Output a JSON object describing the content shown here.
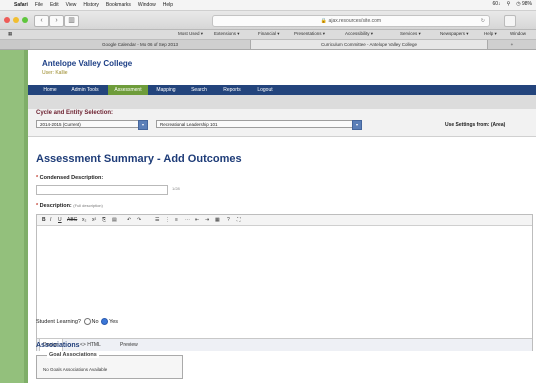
{
  "mac_menubar": {
    "app": "Safari",
    "items": [
      "File",
      "Edit",
      "View",
      "History",
      "Bookmarks",
      "Window",
      "Help"
    ],
    "status": [
      "60↓",
      "⚲",
      "◷ 98%"
    ]
  },
  "browser": {
    "url": "ajax.resources/site.com",
    "bookmarks": [
      "Most Used ▾",
      "Extensions ▾",
      "Financial ▾",
      "Presentations ▾",
      "Accessibility ▾",
      "Services ▾",
      "Newspapers ▾",
      "Help ▾",
      "Window"
    ],
    "tabs": [
      "Google Calendar - Mo 06 of Sep 2013",
      "Curriculum Committee - Antelope Valley College"
    ]
  },
  "site": {
    "college_name": "Antelope Valley College",
    "user_label": "User: Kallie",
    "nav": [
      "Home",
      "Admin Tools",
      "Assessment",
      "Mapping",
      "Search",
      "Reports",
      "Logout"
    ],
    "active_nav": "Assessment"
  },
  "selection": {
    "label": "Cycle and Entity Selection:",
    "cycle": "2014-2015 (Current)",
    "entity": "Recreational Leadership 101",
    "use_settings": "Use Settings from: (Area)"
  },
  "page_title": "Assessment Summary - Add Outcomes",
  "form": {
    "condensed_label": "Condensed Description:",
    "condensed_value": "",
    "counter": "1/28",
    "description_label": "Description:",
    "description_note": "(Full description)",
    "toolbar_icons": [
      "B",
      "I",
      "U",
      "ABC",
      "x₂",
      "x²",
      "⎘",
      "▤",
      "↶",
      "↷",
      "☰",
      "⋮",
      "≡",
      "⋯",
      "⇤",
      "⇥",
      "▦",
      "?",
      "⛶"
    ],
    "editor_tabs": [
      "Design",
      "<> HTML",
      "Preview"
    ],
    "active_editor_tab": "Design",
    "student_learning_label": "Student Learning?",
    "no_label": "No",
    "yes_label": "Yes",
    "selected": "Yes"
  },
  "associations": {
    "heading": "Associations",
    "goal_legend": "Goal Associations",
    "goal_empty": "No Goals Associations Available"
  },
  "colors": {
    "nav_bg": "#23447c",
    "nav_active": "#6e9c3a",
    "title_blue": "#1e3c78",
    "sidebar_green": "#93c07c"
  }
}
